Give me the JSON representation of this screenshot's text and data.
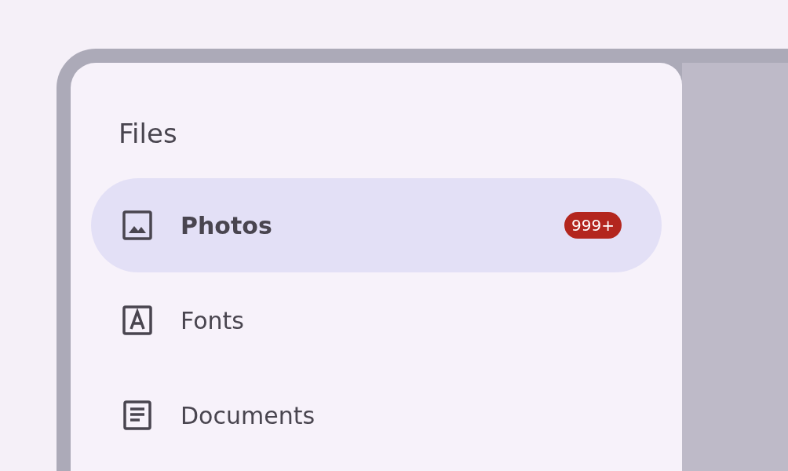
{
  "drawer": {
    "title": "Files",
    "items": [
      {
        "label": "Photos",
        "selected": true,
        "badge": "999+"
      },
      {
        "label": "Fonts",
        "selected": false
      },
      {
        "label": "Documents",
        "selected": false
      }
    ]
  }
}
